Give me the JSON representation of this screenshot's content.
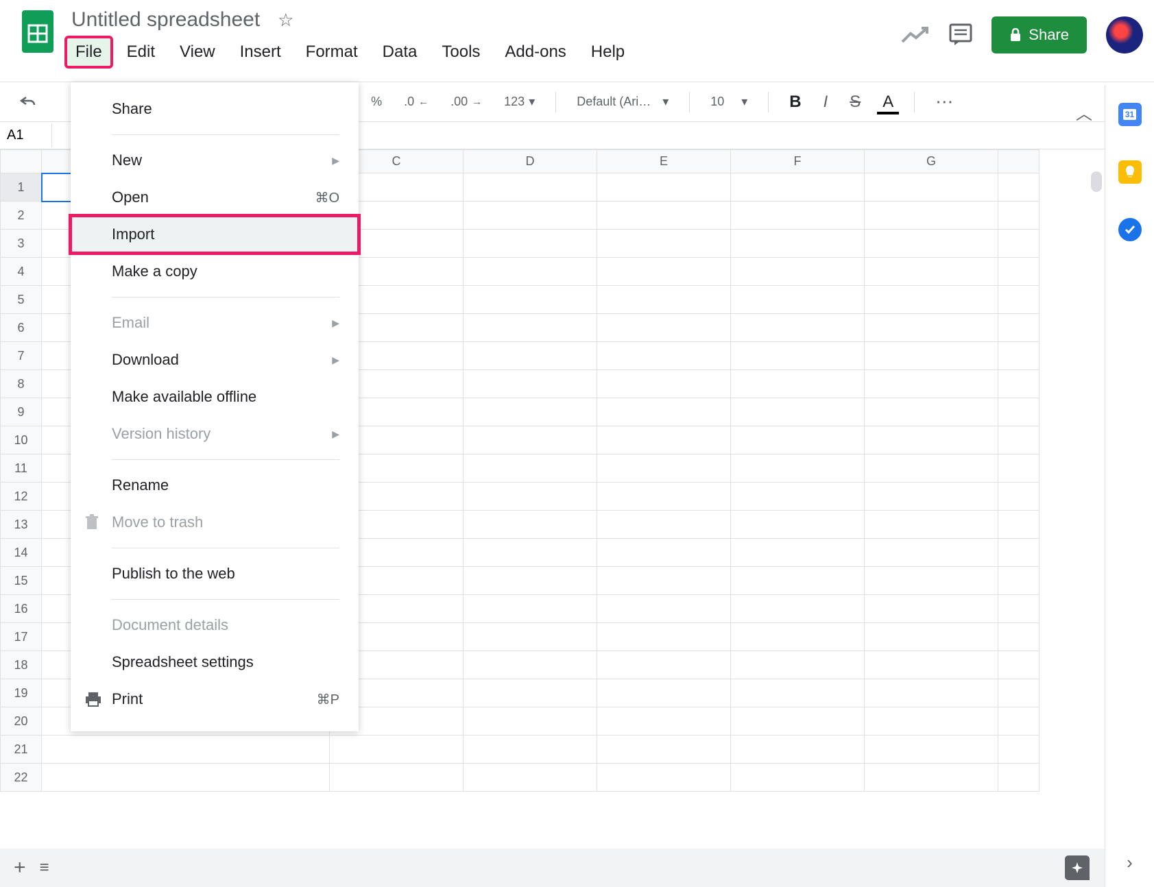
{
  "header": {
    "doc_title": "Untitled spreadsheet",
    "share_label": "Share"
  },
  "menubar": {
    "items": [
      "File",
      "Edit",
      "View",
      "Insert",
      "Format",
      "Data",
      "Tools",
      "Add-ons",
      "Help"
    ],
    "active_index": 0
  },
  "toolbar": {
    "percent": "%",
    "dec_dec": ".0",
    "dec_inc": ".00",
    "num_fmt": "123",
    "font_name": "Default (Ari…",
    "font_size": "10",
    "more": "⋯"
  },
  "namebox": {
    "value": "A1"
  },
  "grid": {
    "columns": [
      "C",
      "D",
      "E",
      "F",
      "G"
    ],
    "rows": [
      1,
      2,
      3,
      4,
      5,
      6,
      7,
      8,
      9,
      10,
      11,
      12,
      13,
      14,
      15,
      16,
      17,
      18,
      19,
      20,
      21,
      22
    ]
  },
  "dropdown": {
    "groups": [
      [
        {
          "label": "Share",
          "shortcut": "",
          "arrow": false,
          "disabled": false,
          "highlight": false
        }
      ],
      [
        {
          "label": "New",
          "shortcut": "",
          "arrow": true,
          "disabled": false,
          "highlight": false
        },
        {
          "label": "Open",
          "shortcut": "⌘O",
          "arrow": false,
          "disabled": false,
          "highlight": false
        },
        {
          "label": "Import",
          "shortcut": "",
          "arrow": false,
          "disabled": false,
          "highlight": true
        },
        {
          "label": "Make a copy",
          "shortcut": "",
          "arrow": false,
          "disabled": false,
          "highlight": false
        }
      ],
      [
        {
          "label": "Email",
          "shortcut": "",
          "arrow": true,
          "disabled": true,
          "highlight": false
        },
        {
          "label": "Download",
          "shortcut": "",
          "arrow": true,
          "disabled": false,
          "highlight": false
        },
        {
          "label": "Make available offline",
          "shortcut": "",
          "arrow": false,
          "disabled": false,
          "highlight": false
        },
        {
          "label": "Version history",
          "shortcut": "",
          "arrow": true,
          "disabled": true,
          "highlight": false
        }
      ],
      [
        {
          "label": "Rename",
          "shortcut": "",
          "arrow": false,
          "disabled": false,
          "highlight": false
        },
        {
          "label": "Move to trash",
          "shortcut": "",
          "arrow": false,
          "disabled": true,
          "highlight": false,
          "icon": "trash"
        }
      ],
      [
        {
          "label": "Publish to the web",
          "shortcut": "",
          "arrow": false,
          "disabled": false,
          "highlight": false
        }
      ],
      [
        {
          "label": "Document details",
          "shortcut": "",
          "arrow": false,
          "disabled": true,
          "highlight": false
        },
        {
          "label": "Spreadsheet settings",
          "shortcut": "",
          "arrow": false,
          "disabled": false,
          "highlight": false
        },
        {
          "label": "Print",
          "shortcut": "⌘P",
          "arrow": false,
          "disabled": false,
          "highlight": false,
          "icon": "print"
        }
      ]
    ]
  }
}
